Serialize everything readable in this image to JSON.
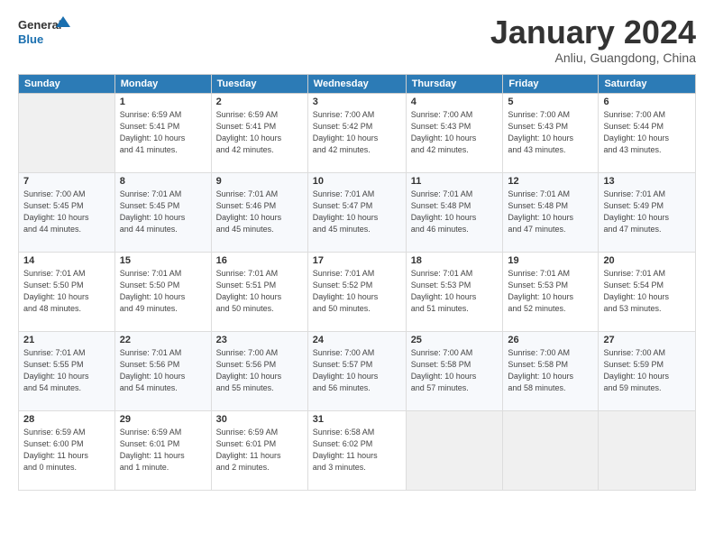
{
  "header": {
    "logo_general": "General",
    "logo_blue": "Blue",
    "month_title": "January 2024",
    "subtitle": "Anliu, Guangdong, China"
  },
  "weekdays": [
    "Sunday",
    "Monday",
    "Tuesday",
    "Wednesday",
    "Thursday",
    "Friday",
    "Saturday"
  ],
  "weeks": [
    [
      {
        "num": "",
        "info": ""
      },
      {
        "num": "1",
        "info": "Sunrise: 6:59 AM\nSunset: 5:41 PM\nDaylight: 10 hours\nand 41 minutes."
      },
      {
        "num": "2",
        "info": "Sunrise: 6:59 AM\nSunset: 5:41 PM\nDaylight: 10 hours\nand 42 minutes."
      },
      {
        "num": "3",
        "info": "Sunrise: 7:00 AM\nSunset: 5:42 PM\nDaylight: 10 hours\nand 42 minutes."
      },
      {
        "num": "4",
        "info": "Sunrise: 7:00 AM\nSunset: 5:43 PM\nDaylight: 10 hours\nand 42 minutes."
      },
      {
        "num": "5",
        "info": "Sunrise: 7:00 AM\nSunset: 5:43 PM\nDaylight: 10 hours\nand 43 minutes."
      },
      {
        "num": "6",
        "info": "Sunrise: 7:00 AM\nSunset: 5:44 PM\nDaylight: 10 hours\nand 43 minutes."
      }
    ],
    [
      {
        "num": "7",
        "info": "Sunrise: 7:00 AM\nSunset: 5:45 PM\nDaylight: 10 hours\nand 44 minutes."
      },
      {
        "num": "8",
        "info": "Sunrise: 7:01 AM\nSunset: 5:45 PM\nDaylight: 10 hours\nand 44 minutes."
      },
      {
        "num": "9",
        "info": "Sunrise: 7:01 AM\nSunset: 5:46 PM\nDaylight: 10 hours\nand 45 minutes."
      },
      {
        "num": "10",
        "info": "Sunrise: 7:01 AM\nSunset: 5:47 PM\nDaylight: 10 hours\nand 45 minutes."
      },
      {
        "num": "11",
        "info": "Sunrise: 7:01 AM\nSunset: 5:48 PM\nDaylight: 10 hours\nand 46 minutes."
      },
      {
        "num": "12",
        "info": "Sunrise: 7:01 AM\nSunset: 5:48 PM\nDaylight: 10 hours\nand 47 minutes."
      },
      {
        "num": "13",
        "info": "Sunrise: 7:01 AM\nSunset: 5:49 PM\nDaylight: 10 hours\nand 47 minutes."
      }
    ],
    [
      {
        "num": "14",
        "info": "Sunrise: 7:01 AM\nSunset: 5:50 PM\nDaylight: 10 hours\nand 48 minutes."
      },
      {
        "num": "15",
        "info": "Sunrise: 7:01 AM\nSunset: 5:50 PM\nDaylight: 10 hours\nand 49 minutes."
      },
      {
        "num": "16",
        "info": "Sunrise: 7:01 AM\nSunset: 5:51 PM\nDaylight: 10 hours\nand 50 minutes."
      },
      {
        "num": "17",
        "info": "Sunrise: 7:01 AM\nSunset: 5:52 PM\nDaylight: 10 hours\nand 50 minutes."
      },
      {
        "num": "18",
        "info": "Sunrise: 7:01 AM\nSunset: 5:53 PM\nDaylight: 10 hours\nand 51 minutes."
      },
      {
        "num": "19",
        "info": "Sunrise: 7:01 AM\nSunset: 5:53 PM\nDaylight: 10 hours\nand 52 minutes."
      },
      {
        "num": "20",
        "info": "Sunrise: 7:01 AM\nSunset: 5:54 PM\nDaylight: 10 hours\nand 53 minutes."
      }
    ],
    [
      {
        "num": "21",
        "info": "Sunrise: 7:01 AM\nSunset: 5:55 PM\nDaylight: 10 hours\nand 54 minutes."
      },
      {
        "num": "22",
        "info": "Sunrise: 7:01 AM\nSunset: 5:56 PM\nDaylight: 10 hours\nand 54 minutes."
      },
      {
        "num": "23",
        "info": "Sunrise: 7:00 AM\nSunset: 5:56 PM\nDaylight: 10 hours\nand 55 minutes."
      },
      {
        "num": "24",
        "info": "Sunrise: 7:00 AM\nSunset: 5:57 PM\nDaylight: 10 hours\nand 56 minutes."
      },
      {
        "num": "25",
        "info": "Sunrise: 7:00 AM\nSunset: 5:58 PM\nDaylight: 10 hours\nand 57 minutes."
      },
      {
        "num": "26",
        "info": "Sunrise: 7:00 AM\nSunset: 5:58 PM\nDaylight: 10 hours\nand 58 minutes."
      },
      {
        "num": "27",
        "info": "Sunrise: 7:00 AM\nSunset: 5:59 PM\nDaylight: 10 hours\nand 59 minutes."
      }
    ],
    [
      {
        "num": "28",
        "info": "Sunrise: 6:59 AM\nSunset: 6:00 PM\nDaylight: 11 hours\nand 0 minutes."
      },
      {
        "num": "29",
        "info": "Sunrise: 6:59 AM\nSunset: 6:01 PM\nDaylight: 11 hours\nand 1 minute."
      },
      {
        "num": "30",
        "info": "Sunrise: 6:59 AM\nSunset: 6:01 PM\nDaylight: 11 hours\nand 2 minutes."
      },
      {
        "num": "31",
        "info": "Sunrise: 6:58 AM\nSunset: 6:02 PM\nDaylight: 11 hours\nand 3 minutes."
      },
      {
        "num": "",
        "info": ""
      },
      {
        "num": "",
        "info": ""
      },
      {
        "num": "",
        "info": ""
      }
    ]
  ]
}
